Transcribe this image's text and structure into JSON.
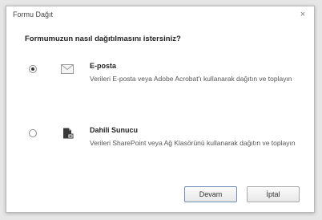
{
  "window": {
    "title": "Formu Dağıt",
    "close_glyph": "×"
  },
  "dialog": {
    "question": "Formumuzun nasıl dağıtılmasını istersiniz?",
    "options": [
      {
        "title": "E-posta",
        "description": "Verileri E-posta veya Adobe Acrobat'ı kullanarak dağıtın ve toplayın",
        "selected": true,
        "icon": "email-envelope-icon"
      },
      {
        "title": "Dahili Sunucu",
        "description": "Verileri SharePoint veya Ağ Klasörünü kullanarak dağıtın ve toplayın",
        "selected": false,
        "icon": "internal-server-document-icon"
      }
    ],
    "buttons": {
      "next": "Devam",
      "cancel": "İptal"
    }
  }
}
